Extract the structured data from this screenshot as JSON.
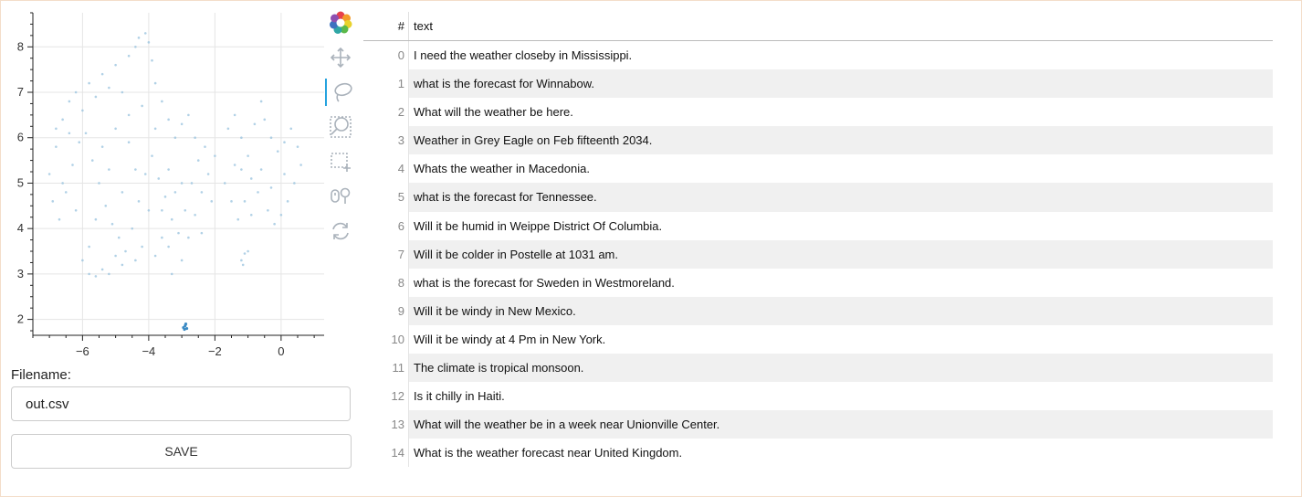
{
  "chart_data": {
    "type": "scatter",
    "title": "",
    "xlabel": "",
    "ylabel": "",
    "xlim": [
      -7.5,
      1.3
    ],
    "ylim": [
      1.65,
      8.75
    ],
    "x_ticks": [
      -6,
      -4,
      -2,
      0
    ],
    "x_tick_labels": [
      "−6",
      "−4",
      "−2",
      "0"
    ],
    "y_ticks": [
      2,
      3,
      4,
      5,
      6,
      7,
      8
    ],
    "y_tick_labels": [
      "2",
      "3",
      "4",
      "5",
      "6",
      "7",
      "8"
    ],
    "grid": true,
    "marker_color": "#9ec6e0",
    "highlight_color": "#3b8ac4",
    "points": [
      [
        -7.0,
        5.2
      ],
      [
        -6.8,
        5.8
      ],
      [
        -6.6,
        6.4
      ],
      [
        -6.4,
        6.8
      ],
      [
        -6.2,
        7.0
      ],
      [
        -6.0,
        6.6
      ],
      [
        -5.8,
        7.2
      ],
      [
        -5.6,
        6.9
      ],
      [
        -5.4,
        7.4
      ],
      [
        -5.2,
        7.1
      ],
      [
        -5.0,
        7.6
      ],
      [
        -4.8,
        7.0
      ],
      [
        -4.6,
        7.8
      ],
      [
        -4.4,
        8.0
      ],
      [
        -4.3,
        8.2
      ],
      [
        -4.1,
        8.3
      ],
      [
        -4.0,
        8.1
      ],
      [
        -3.9,
        7.7
      ],
      [
        -3.8,
        7.2
      ],
      [
        -3.6,
        6.8
      ],
      [
        -3.4,
        6.4
      ],
      [
        -3.2,
        6.0
      ],
      [
        -3.0,
        6.3
      ],
      [
        -2.8,
        6.5
      ],
      [
        -6.9,
        4.6
      ],
      [
        -6.7,
        4.2
      ],
      [
        -6.5,
        4.8
      ],
      [
        -6.3,
        5.4
      ],
      [
        -6.1,
        5.9
      ],
      [
        -5.9,
        6.1
      ],
      [
        -5.7,
        5.5
      ],
      [
        -5.5,
        5.0
      ],
      [
        -5.3,
        4.5
      ],
      [
        -5.1,
        4.1
      ],
      [
        -4.9,
        3.8
      ],
      [
        -4.7,
        3.5
      ],
      [
        -4.5,
        4.0
      ],
      [
        -4.3,
        4.6
      ],
      [
        -4.1,
        5.2
      ],
      [
        -3.9,
        5.6
      ],
      [
        -3.7,
        5.1
      ],
      [
        -3.5,
        4.7
      ],
      [
        -3.3,
        4.2
      ],
      [
        -3.1,
        3.9
      ],
      [
        -2.9,
        4.4
      ],
      [
        -2.7,
        5.0
      ],
      [
        -2.5,
        5.5
      ],
      [
        -2.3,
        5.8
      ],
      [
        -6.0,
        3.3
      ],
      [
        -5.8,
        3.0
      ],
      [
        -5.6,
        2.95
      ],
      [
        -5.4,
        3.1
      ],
      [
        -5.2,
        3.0
      ],
      [
        -5.0,
        3.4
      ],
      [
        -4.8,
        3.2
      ],
      [
        -4.4,
        3.3
      ],
      [
        -4.2,
        3.6
      ],
      [
        -3.8,
        3.4
      ],
      [
        -3.6,
        3.8
      ],
      [
        -3.4,
        3.6
      ],
      [
        -2.6,
        4.3
      ],
      [
        -2.4,
        4.8
      ],
      [
        -2.2,
        5.2
      ],
      [
        -2.0,
        5.6
      ],
      [
        -2.1,
        4.6
      ],
      [
        -2.4,
        3.9
      ],
      [
        -1.6,
        6.2
      ],
      [
        -1.4,
        6.5
      ],
      [
        -1.2,
        6.0
      ],
      [
        -1.0,
        5.6
      ],
      [
        -0.8,
        6.3
      ],
      [
        -0.6,
        6.8
      ],
      [
        -0.5,
        6.4
      ],
      [
        -0.3,
        6.0
      ],
      [
        -0.1,
        5.7
      ],
      [
        0.1,
        5.9
      ],
      [
        0.3,
        6.2
      ],
      [
        0.5,
        5.8
      ],
      [
        0.6,
        5.4
      ],
      [
        0.4,
        5.0
      ],
      [
        0.2,
        4.6
      ],
      [
        0.0,
        4.3
      ],
      [
        -0.2,
        4.1
      ],
      [
        -0.4,
        4.4
      ],
      [
        -0.7,
        4.8
      ],
      [
        -0.9,
        5.1
      ],
      [
        -1.1,
        4.6
      ],
      [
        -1.3,
        4.2
      ],
      [
        -1.5,
        4.6
      ],
      [
        -1.7,
        5.0
      ],
      [
        -1.4,
        5.4
      ],
      [
        -1.2,
        5.3
      ],
      [
        -0.9,
        4.3
      ],
      [
        -0.6,
        5.3
      ],
      [
        -0.3,
        4.9
      ],
      [
        0.1,
        5.2
      ],
      [
        -1.2,
        3.3
      ],
      [
        -1.15,
        3.2
      ],
      [
        -1.1,
        3.45
      ],
      [
        -1.0,
        3.5
      ],
      [
        -6.6,
        5.0
      ],
      [
        -6.2,
        4.4
      ],
      [
        -5.6,
        4.2
      ],
      [
        -5.4,
        5.8
      ],
      [
        -5.0,
        6.2
      ],
      [
        -4.6,
        5.9
      ],
      [
        -4.6,
        6.5
      ],
      [
        -4.2,
        6.7
      ],
      [
        -3.8,
        6.2
      ],
      [
        -3.4,
        5.3
      ],
      [
        -3.0,
        5.0
      ],
      [
        -2.6,
        6.0
      ],
      [
        -6.4,
        6.1
      ],
      [
        -6.8,
        6.2
      ],
      [
        -5.2,
        5.3
      ],
      [
        -4.8,
        4.8
      ],
      [
        -4.4,
        5.3
      ],
      [
        -4.0,
        4.4
      ],
      [
        -3.6,
        4.4
      ],
      [
        -3.2,
        4.8
      ],
      [
        -2.8,
        3.8
      ],
      [
        -3.0,
        3.3
      ],
      [
        -3.3,
        3.0
      ],
      [
        -5.8,
        3.6
      ]
    ],
    "highlight_points": [
      [
        -2.95,
        1.82
      ],
      [
        -2.9,
        1.86
      ],
      [
        -2.85,
        1.8
      ],
      [
        -2.92,
        1.78
      ],
      [
        -2.88,
        1.9
      ]
    ]
  },
  "toolbar": {
    "tools": [
      {
        "name": "bokeh-logo-icon",
        "active": false
      },
      {
        "name": "pan-icon",
        "active": false
      },
      {
        "name": "lasso-select-icon",
        "active": true
      },
      {
        "name": "wheel-zoom-icon",
        "active": false
      },
      {
        "name": "box-select-icon",
        "active": false
      },
      {
        "name": "hover-icon",
        "active": false
      },
      {
        "name": "reset-icon",
        "active": false
      }
    ]
  },
  "form": {
    "filename_label": "Filename:",
    "filename_value": "out.csv",
    "save_label": "SAVE"
  },
  "table": {
    "index_header": "#",
    "text_header": "text",
    "rows": [
      {
        "index": "0",
        "text": "I need the weather closeby in Mississippi."
      },
      {
        "index": "1",
        "text": "what is the forecast for Winnabow."
      },
      {
        "index": "2",
        "text": "What will the weather be here."
      },
      {
        "index": "3",
        "text": "Weather in Grey Eagle on Feb fifteenth 2034."
      },
      {
        "index": "4",
        "text": "Whats the weather in Macedonia."
      },
      {
        "index": "5",
        "text": "what is the forecast for Tennessee."
      },
      {
        "index": "6",
        "text": "Will it be humid in Weippe District Of Columbia."
      },
      {
        "index": "7",
        "text": "Will it be colder in Postelle at 1031 am."
      },
      {
        "index": "8",
        "text": "what is the forecast for Sweden in Westmoreland."
      },
      {
        "index": "9",
        "text": "Will it be windy in New Mexico."
      },
      {
        "index": "10",
        "text": "Will it be windy at 4 Pm in New York."
      },
      {
        "index": "11",
        "text": "The climate is tropical monsoon."
      },
      {
        "index": "12",
        "text": "Is it chilly in Haiti."
      },
      {
        "index": "13",
        "text": "What will the weather be in a week near Unionville Center."
      },
      {
        "index": "14",
        "text": "What is the weather forecast near United Kingdom."
      }
    ]
  }
}
